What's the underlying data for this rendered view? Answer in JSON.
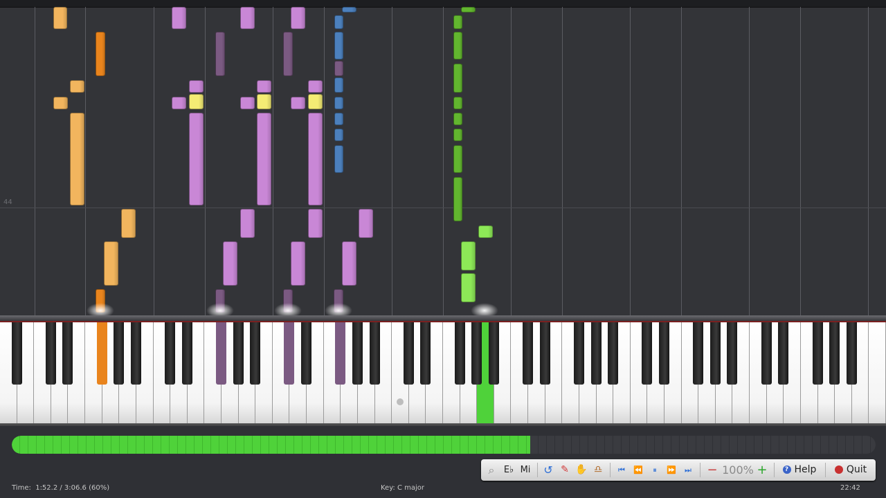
{
  "roll": {
    "measure_number": "44",
    "colors": {
      "orange_light": "#f2b55e",
      "orange_dark": "#e9841d",
      "purple_light": "#c987d6",
      "purple_dark": "#7b5a82",
      "yellow": "#f4ec74",
      "blue": "#4c80bd",
      "green_dark": "#62b62f",
      "green_light": "#8de857"
    }
  },
  "keyboard": {
    "pressed_keys": [
      {
        "color": "#e9841d"
      },
      {
        "color": "#7b5a82"
      },
      {
        "color": "#7b5a82"
      },
      {
        "color": "#7b5a82"
      },
      {
        "color": "#4fd23a"
      }
    ]
  },
  "progress": {
    "fraction": 0.6,
    "fill_color": "#4fd23a"
  },
  "toolbar": {
    "zoom_icon": "magnifier-icon",
    "key_label": "E♭",
    "mode_label": "Mi",
    "undo_icon": "loop-icon",
    "pencil_icon": "pencil-icon",
    "hand_icon": "hand-icon",
    "metronome_icon": "metronome-icon",
    "skip_start": "⏮",
    "rewind": "⏪",
    "pause": "⏸",
    "forward": "⏩",
    "skip_end": "⏭",
    "speed_minus": "−",
    "speed_value": "100%",
    "speed_plus": "+",
    "help_label": "Help",
    "quit_label": "Quit"
  },
  "status": {
    "time_label": "Time:",
    "time_value": "1:52.2 / 3:06.6 (60%)",
    "key_text": "Key: C major",
    "clock": "22:42"
  }
}
